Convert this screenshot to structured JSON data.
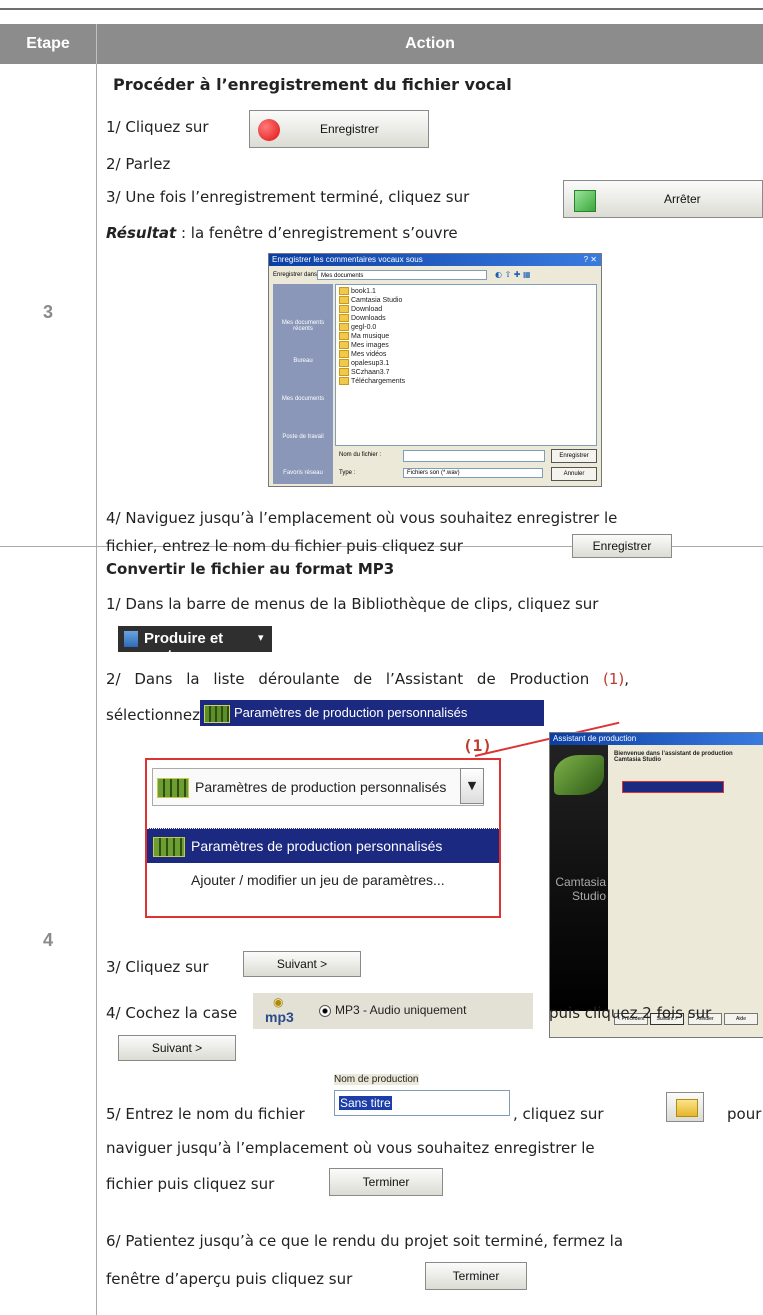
{
  "header": {
    "col_step": "Etape",
    "col_action": "Action"
  },
  "step3": {
    "number": "3",
    "title": "Procéder à l’enregistrement du fichier vocal",
    "line1_prefix": "1/ Cliquez sur",
    "record_button": "Enregistrer",
    "line2": "2/ Parlez",
    "line3_prefix": "3/ Une fois l’enregistrement terminé, cliquez sur",
    "stop_button": "Arrêter",
    "result_label": "Résultat",
    "result_text": " : la fenêtre d’enregistrement s’ouvre",
    "dialog": {
      "title": "Enregistrer les commentaires vocaux sous",
      "save_in_label": "Enregistrer dans :",
      "save_in_value": "Mes documents",
      "places": [
        "Mes documents récents",
        "Bureau",
        "Mes documents",
        "Poste de travail",
        "Favoris réseau"
      ],
      "files": [
        "book1.1",
        "Camtasia Studio",
        "Download",
        "Downloads",
        "gegl-0.0",
        "Ma musique",
        "Mes images",
        "Mes vidéos",
        "opalesup3.1",
        "SCzhaan3.7",
        "Téléchargements"
      ],
      "filename_label": "Nom du fichier :",
      "type_label": "Type :",
      "type_value": "Fichiers son (*.wav)",
      "save_button": "Enregistrer",
      "cancel_button": "Annuler"
    },
    "line4_a": "4/ Naviguez jusqu’à l’emplacement où vous souhaitez enregistrer le",
    "line4_b": "fichier, entrez le nom du fichier puis cliquez sur",
    "save_button": "Enregistrer"
  },
  "step4": {
    "number": "4",
    "title": "Convertir le fichier au format MP3",
    "line1": "1/ Dans la barre de menus de la Bibliothèque de clips, cliquez sur",
    "produce_button": "Produire et partager",
    "line2_a": "2/ Dans la liste déroulante de l’Assistant de Production",
    "line2_marker": "(1)",
    "line2_end": ",",
    "line2_b": "sélectionnez",
    "preset_label": "Paramètres de production personnalisés",
    "callout": "(1)",
    "dropdown_value": "Paramètres de production personnalisés",
    "dropdown_option1": "Paramètres de production personnalisés",
    "dropdown_option2": "Ajouter / modifier un jeu de paramètres...",
    "wizard": {
      "title": "Assistant de production",
      "brand": "Camtasia Studio",
      "welcome": "Bienvenue dans l’assistant de production Camtasia Studio",
      "buttons": [
        "< Précédent",
        "Suivant >",
        "Annuler",
        "Aide"
      ]
    },
    "line3_prefix": "3/ Cliquez sur",
    "next_button": "Suivant >",
    "line4_prefix": "4/ Cochez la case",
    "mp3_label": "MP3 - Audio uniquement",
    "mp3_icon_text": "mp3",
    "line4_suffix": "puis cliquez 2 fois sur",
    "next_button2": "Suivant >",
    "prod_name_label": "Nom de production",
    "prod_name_value": "Sans titre",
    "line5_a": "5/ Entrez le nom du fichier",
    "line5_mid": ", cliquez sur",
    "line5_end": "pour",
    "line5_b": "naviguer jusqu’à l’emplacement où vous souhaitez enregistrer le",
    "line5_c": "fichier puis cliquez sur",
    "finish_button": "Terminer",
    "line6_a": "6/ Patientez jusqu’à ce que le rendu du projet soit terminé, fermez la",
    "line6_b": "fenêtre d’aperçu puis cliquez sur",
    "finish_button2": "Terminer"
  }
}
